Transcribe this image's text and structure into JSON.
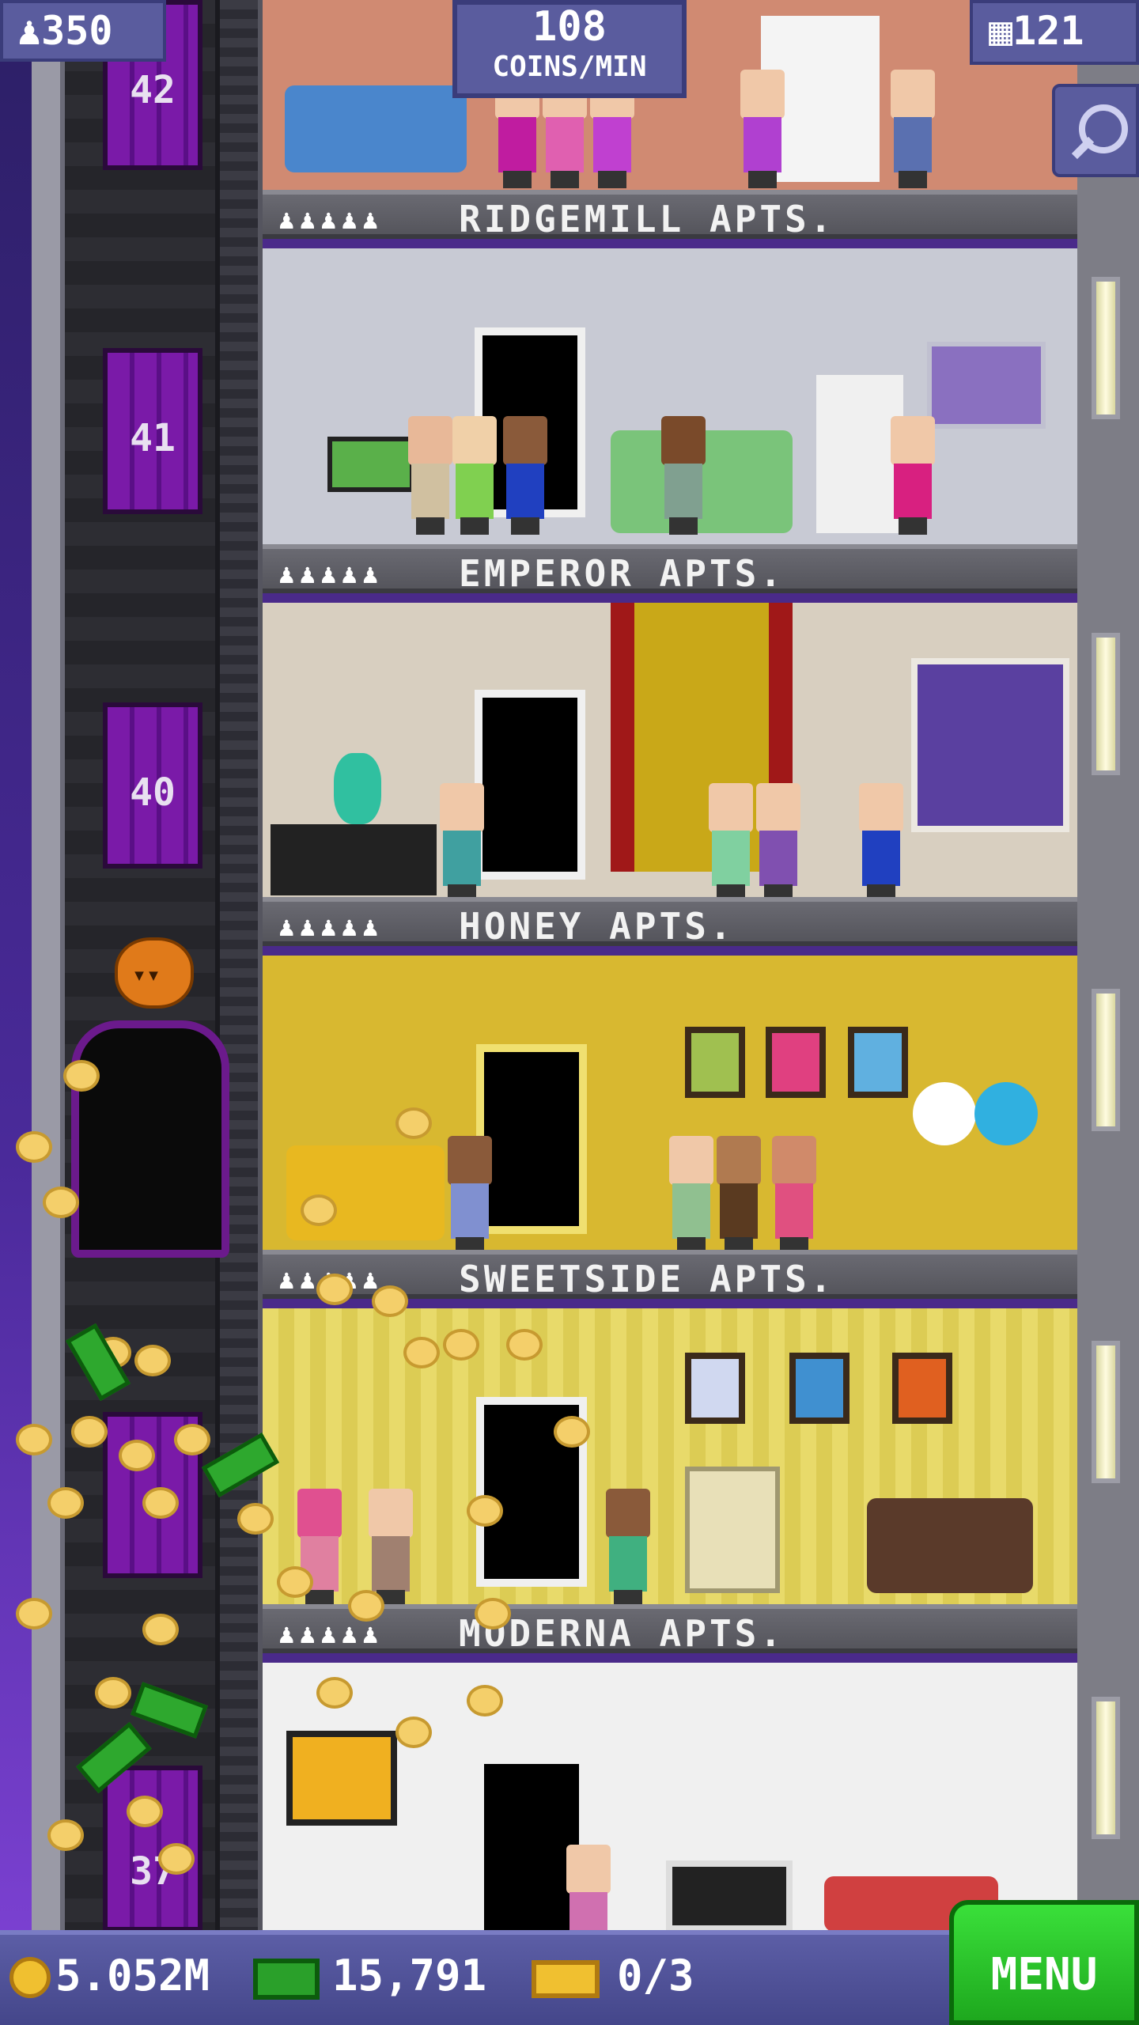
{
  "hud": {
    "population": "350",
    "coins_per_min_value": "108",
    "coins_per_min_label": "COINS/MIN",
    "floor_count": "121",
    "coins": "5.052M",
    "tower_bux": "15,791",
    "tickets": "0/3",
    "menu_label": "MENU"
  },
  "elevator": {
    "floor_numbers": [
      "42",
      "41",
      "40",
      "37"
    ]
  },
  "floors": [
    {
      "name": "RIDGEMILL APTS.",
      "residents_icons": "♟♟♟♟♟"
    },
    {
      "name": "EMPEROR APTS.",
      "residents_icons": "♟♟♟♟♟"
    },
    {
      "name": "HONEY APTS.",
      "residents_icons": "♟♟♟♟♟"
    },
    {
      "name": "SWEETSIDE APTS.",
      "residents_icons": "♟♟♟♟♟"
    },
    {
      "name": "MODERNA APTS.",
      "residents_icons": "♟♟♟♟♟"
    }
  ],
  "icons": {
    "population": "person-icon",
    "floors": "building-icon",
    "zoom": "magnifier-icon",
    "coins": "coin-icon",
    "bux": "tower-bux-icon",
    "tickets": "ticket-icon"
  },
  "colors": {
    "menu": "#1ea81e",
    "hud": "#5a5c9e",
    "elevator_door": "#7a1aa8"
  }
}
